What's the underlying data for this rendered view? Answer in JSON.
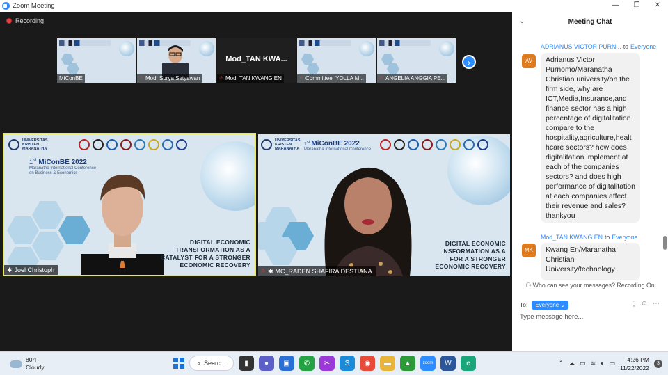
{
  "window": {
    "title": "Zoom Meeting",
    "controls": [
      "—",
      "❐",
      "✕"
    ]
  },
  "meeting": {
    "recording_label": "Recording",
    "thumbnails": [
      {
        "name": "MiConBE",
        "muted": false
      },
      {
        "name": "Mod_Surya Setyawan",
        "muted": true
      },
      {
        "name": "Mod_TAN KWANG EN",
        "muted": true,
        "display_name": "Mod_TAN  KWA..."
      },
      {
        "name": "Committee_YOLLA M...",
        "muted": true
      },
      {
        "name": "ANGELIA ANGGIA PE...",
        "muted": true
      }
    ],
    "next_arrow": "›",
    "videos": [
      {
        "name": "Joel Christoph",
        "active": true
      },
      {
        "name": "MC_RADEN SHAFIRA DESTIANA",
        "active": false
      }
    ],
    "slide": {
      "university_line1": "UNIVERSITAS",
      "university_line2": "KRISTEN",
      "university_line3": "MARANATHA",
      "conference_prefix": "1",
      "conference_sup": "st",
      "conference_name": "MiConBE 2022",
      "conference_sub1": "Maranatha International Conference",
      "conference_sub2": "on Business & Economics",
      "headline_line1": "DIGITAL ECONOMIC",
      "headline_line2": "TRANSFORMATION AS A",
      "headline_line3": "CATALYST FOR A STRONGER",
      "headline_line4": "ECONOMIC RECOVERY",
      "headline2_line1": "DIGITAL ECONOMIC",
      "headline2_line2": "NSFORMATION AS A",
      "headline2_line3": "FOR A STRONGER",
      "headline2_line4": "ECONOMIC RECOVERY"
    }
  },
  "chat": {
    "title": "Meeting Chat",
    "messages": [
      {
        "sender": "ADRIANUS VICTOR PURN...",
        "to_word": "to",
        "recipient": "Everyone",
        "initials": "AV",
        "text": "Adrianus Victor Purnomo/Maranatha Christian university/on the firm side, why are ICT,Media,Insurance,and finance sector has a high percentage of digitalitation compare to the hospitality,agriculture,healt hcare sectors? how does digitalitation implement at each of the companies sectors? and does high performance of digitalitation at each companies affect their revenue and sales?thankyou"
      },
      {
        "sender": "Mod_TAN KWANG EN",
        "to_word": "to",
        "recipient": "Everyone",
        "initials": "MK",
        "text": "Kwang En/Maranatha Christian University/technology"
      }
    ],
    "who_can_see": "Who can see your messages? Recording On",
    "to_label": "To:",
    "to_value": "Everyone",
    "input_placeholder": "Type message here..."
  },
  "taskbar": {
    "weather_temp": "80°F",
    "weather_desc": "Cloudy",
    "search_label": "Search",
    "time": "4:26 PM",
    "date": "11/22/2022",
    "notification_count": "3"
  }
}
